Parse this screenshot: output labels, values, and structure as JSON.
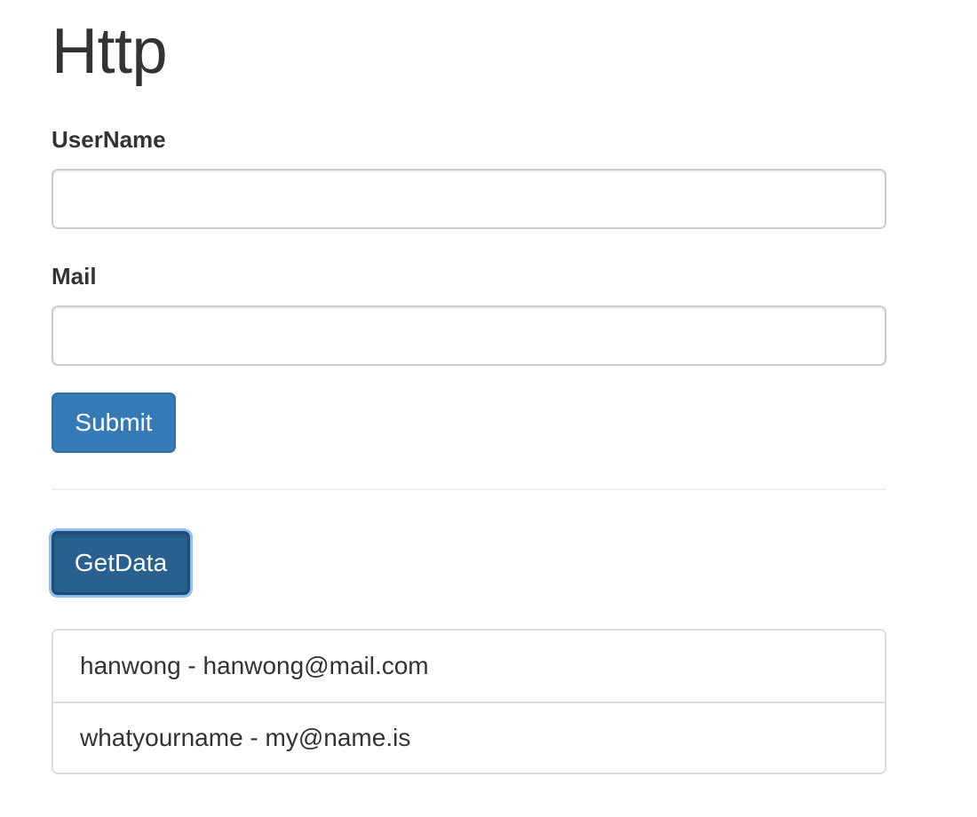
{
  "page": {
    "title": "Http"
  },
  "form": {
    "username_label": "UserName",
    "username_value": "",
    "mail_label": "Mail",
    "mail_value": "",
    "submit_label": "Submit"
  },
  "getdata_label": "GetData",
  "results": [
    {
      "text": "hanwong - hanwong@mail.com"
    },
    {
      "text": "whatyourname - my@name.is"
    }
  ],
  "colors": {
    "primary": "#337ab7",
    "primary_active": "#286090",
    "focus_ring": "#8ec0f5",
    "text": "#333333"
  }
}
